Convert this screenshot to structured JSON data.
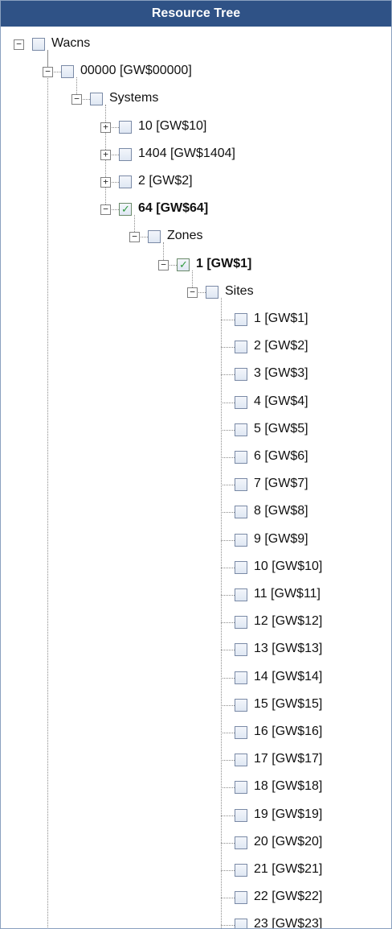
{
  "panel": {
    "title": "Resource Tree"
  },
  "tree": [
    {
      "label": "Wacns",
      "level": 0,
      "expander": "minus",
      "checked": false,
      "bold": false
    },
    {
      "label": "00000 [GW$00000]",
      "level": 1,
      "expander": "minus",
      "checked": false,
      "bold": false
    },
    {
      "label": "Systems",
      "level": 2,
      "expander": "minus",
      "checked": false,
      "bold": false
    },
    {
      "label": "10 [GW$10]",
      "level": 3,
      "expander": "plus",
      "checked": false,
      "bold": false
    },
    {
      "label": "1404 [GW$1404]",
      "level": 3,
      "expander": "plus",
      "checked": false,
      "bold": false
    },
    {
      "label": "2 [GW$2]",
      "level": 3,
      "expander": "plus",
      "checked": false,
      "bold": false
    },
    {
      "label": "64 [GW$64]",
      "level": 3,
      "expander": "minus",
      "checked": true,
      "bold": true
    },
    {
      "label": "Zones",
      "level": 4,
      "expander": "minus",
      "checked": false,
      "bold": false
    },
    {
      "label": "1 [GW$1]",
      "level": 5,
      "expander": "minus",
      "checked": true,
      "bold": true
    },
    {
      "label": "Sites",
      "level": 6,
      "expander": "minus",
      "checked": false,
      "bold": false
    },
    {
      "label": "1 [GW$1]",
      "level": 7,
      "expander": "none",
      "checked": false,
      "bold": false
    },
    {
      "label": "2 [GW$2]",
      "level": 7,
      "expander": "none",
      "checked": false,
      "bold": false
    },
    {
      "label": "3 [GW$3]",
      "level": 7,
      "expander": "none",
      "checked": false,
      "bold": false
    },
    {
      "label": "4 [GW$4]",
      "level": 7,
      "expander": "none",
      "checked": false,
      "bold": false
    },
    {
      "label": "5 [GW$5]",
      "level": 7,
      "expander": "none",
      "checked": false,
      "bold": false
    },
    {
      "label": "6 [GW$6]",
      "level": 7,
      "expander": "none",
      "checked": false,
      "bold": false
    },
    {
      "label": "7 [GW$7]",
      "level": 7,
      "expander": "none",
      "checked": false,
      "bold": false
    },
    {
      "label": "8 [GW$8]",
      "level": 7,
      "expander": "none",
      "checked": false,
      "bold": false
    },
    {
      "label": "9 [GW$9]",
      "level": 7,
      "expander": "none",
      "checked": false,
      "bold": false
    },
    {
      "label": "10 [GW$10]",
      "level": 7,
      "expander": "none",
      "checked": false,
      "bold": false
    },
    {
      "label": "11 [GW$11]",
      "level": 7,
      "expander": "none",
      "checked": false,
      "bold": false
    },
    {
      "label": "12 [GW$12]",
      "level": 7,
      "expander": "none",
      "checked": false,
      "bold": false
    },
    {
      "label": "13 [GW$13]",
      "level": 7,
      "expander": "none",
      "checked": false,
      "bold": false
    },
    {
      "label": "14 [GW$14]",
      "level": 7,
      "expander": "none",
      "checked": false,
      "bold": false
    },
    {
      "label": "15 [GW$15]",
      "level": 7,
      "expander": "none",
      "checked": false,
      "bold": false
    },
    {
      "label": "16 [GW$16]",
      "level": 7,
      "expander": "none",
      "checked": false,
      "bold": false
    },
    {
      "label": "17 [GW$17]",
      "level": 7,
      "expander": "none",
      "checked": false,
      "bold": false
    },
    {
      "label": "18 [GW$18]",
      "level": 7,
      "expander": "none",
      "checked": false,
      "bold": false
    },
    {
      "label": "19 [GW$19]",
      "level": 7,
      "expander": "none",
      "checked": false,
      "bold": false
    },
    {
      "label": "20 [GW$20]",
      "level": 7,
      "expander": "none",
      "checked": false,
      "bold": false
    },
    {
      "label": "21 [GW$21]",
      "level": 7,
      "expander": "none",
      "checked": false,
      "bold": false
    },
    {
      "label": "22 [GW$22]",
      "level": 7,
      "expander": "none",
      "checked": false,
      "bold": false
    },
    {
      "label": "23 [GW$23]",
      "level": 7,
      "expander": "none",
      "checked": false,
      "bold": false
    }
  ],
  "colors": {
    "header_bg": "#2f5286",
    "check_green": "#2e9a3c",
    "dotted_line": "#8a8a8a"
  }
}
